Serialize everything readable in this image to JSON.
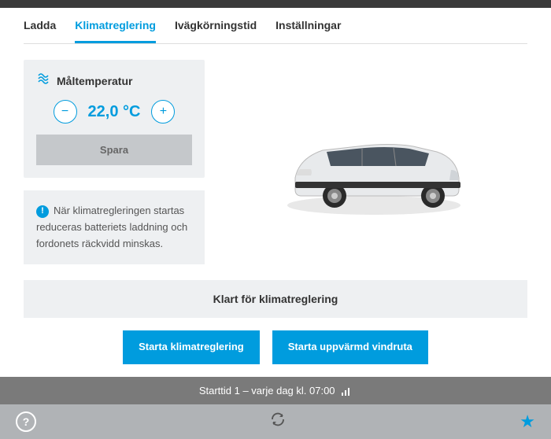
{
  "tabs": {
    "charge": "Ladda",
    "climate": "Klimatreglering",
    "departure": "Ivägkörningstid",
    "settings": "Inställningar"
  },
  "temperature": {
    "title": "Måltemperatur",
    "value": "22,0 °C",
    "save": "Spara"
  },
  "info": {
    "text": "När klimatregleringen startas reduceras batteriets laddning och fordonets räckvidd minskas."
  },
  "status": "Klart för klimatreglering",
  "actions": {
    "start_climate": "Starta klimatreglering",
    "start_windshield": "Starta uppvärmd vindruta"
  },
  "schedule": "Starttid 1 – varje dag kl. 07:00"
}
